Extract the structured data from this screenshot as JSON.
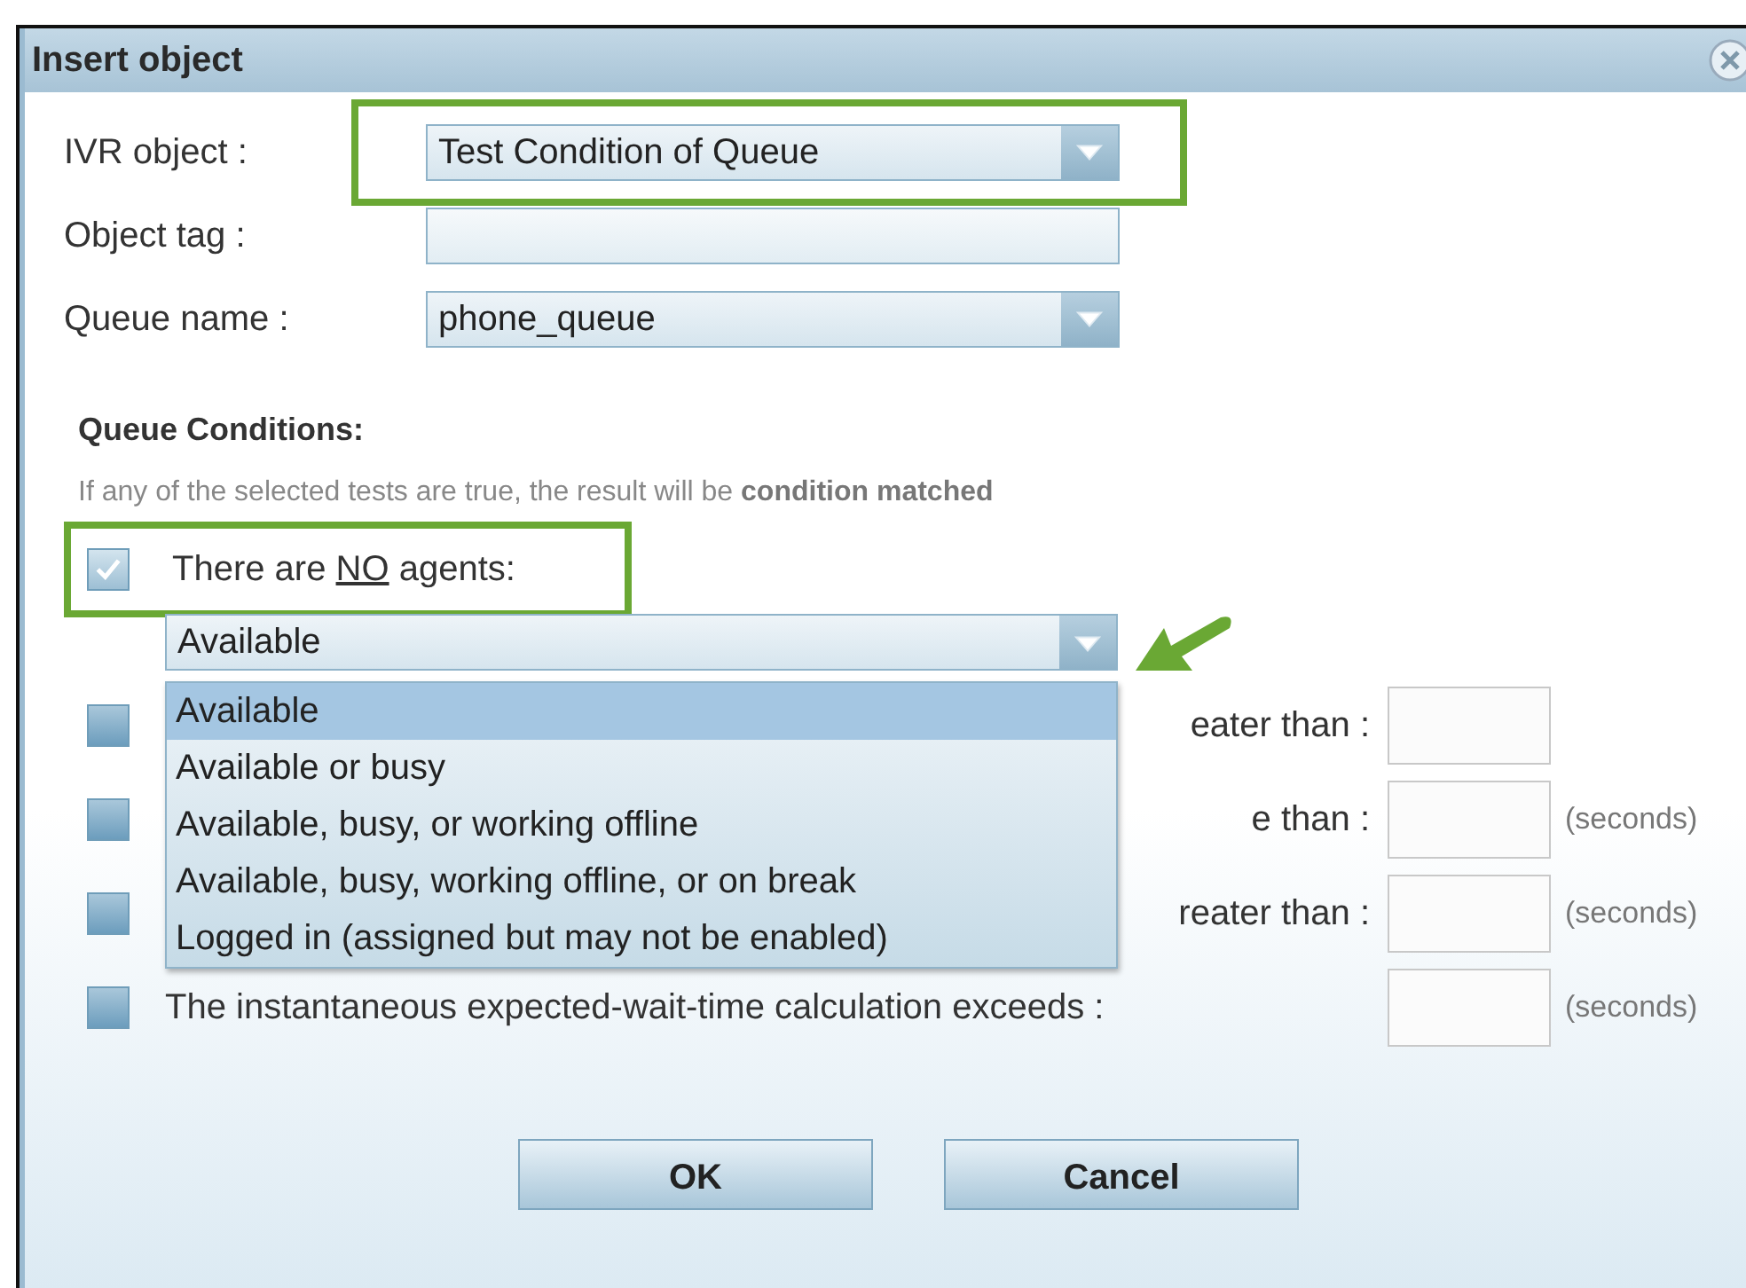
{
  "window": {
    "title": "Insert object"
  },
  "fields": [
    {
      "label": "IVR object :",
      "kind": "select",
      "value": "Test Condition of Queue",
      "highlighted": true
    },
    {
      "label": "Object tag :",
      "kind": "text"
    },
    {
      "label": "Queue name :",
      "kind": "select",
      "value": "phone_queue",
      "highlighted": false
    }
  ],
  "section": {
    "heading": "Queue Conditions:",
    "note": "If any of the selected tests are true, the result will be **condition matched**"
  },
  "no_agents": {
    "label_before": "There are",
    "label_underlined": "NO",
    "label_after": "agents:",
    "checked": true,
    "highlighted": true,
    "dropdown": {
      "value": "Available",
      "expanded": true,
      "pointed_at": true,
      "options": [
        {
          "label": "Available",
          "selected": true
        },
        {
          "label": "Available or busy",
          "selected": false
        },
        {
          "label": "Available, busy, or working offline",
          "selected": false
        },
        {
          "label": "Available, busy, working offline, or on break",
          "selected": false
        },
        {
          "label": "Logged in (assigned but may not be enabled)",
          "selected": false
        }
      ]
    }
  },
  "conditions": [
    {
      "label": "eater than :",
      "checked": false
    },
    {
      "label": "e than :",
      "unit": "(seconds)",
      "checked": false
    },
    {
      "label": "reater than :",
      "unit": "(seconds)",
      "checked": false
    },
    {
      "label": "The instantaneous expected-wait-time calculation exceeds :",
      "unit": "(seconds)",
      "checked": false
    }
  ],
  "buttons": [
    "OK",
    "Cancel"
  ]
}
